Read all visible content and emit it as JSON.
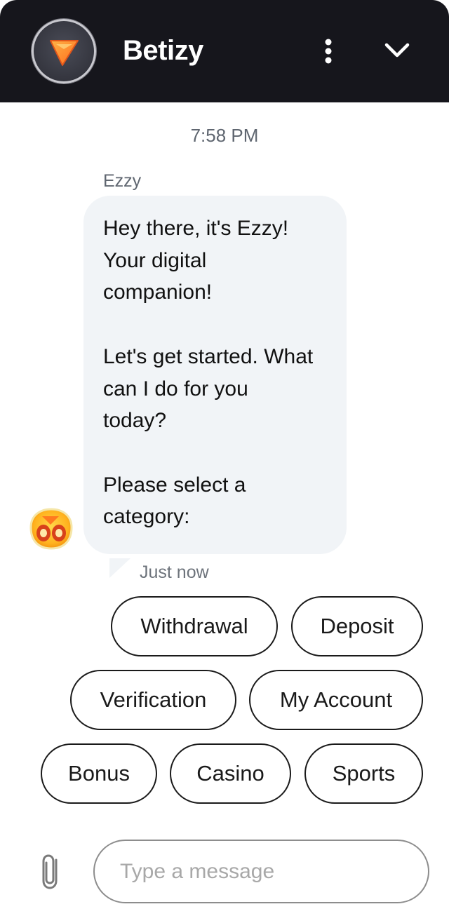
{
  "header": {
    "title": "Betizy",
    "logo_icon": "play-triangle-logo",
    "menu_icon": "vertical-dots-icon",
    "collapse_icon": "chevron-down-icon",
    "background": "#16161c"
  },
  "conversation": {
    "timestamp": "7:58 PM",
    "message": {
      "sender": "Ezzy",
      "paragraphs": [
        "Hey there, it's Ezzy!\nYour digital\ncompanion!",
        "Let's get started. What\ncan I do for you\ntoday?",
        "Please select a\ncategory:"
      ],
      "meta": "Just now",
      "bubble_color": "#f1f4f7",
      "avatar_icon": "ezzy-mascot-icon"
    }
  },
  "quick_replies": {
    "options": [
      "Withdrawal",
      "Deposit",
      "Verification",
      "My Account",
      "Bonus",
      "Casino",
      "Sports"
    ]
  },
  "composer": {
    "placeholder": "Type a message",
    "value": "",
    "attach_icon": "paperclip-icon"
  }
}
